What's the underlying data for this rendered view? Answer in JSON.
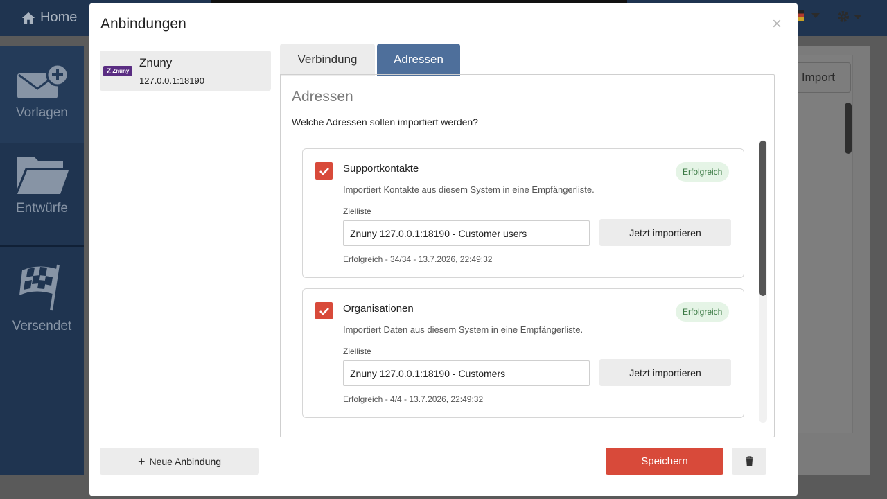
{
  "app": {
    "home_label": "Home",
    "sidebar": [
      {
        "label": "Vorlagen",
        "icon": "mail-plus-icon"
      },
      {
        "label": "Entwürfe",
        "icon": "folder-icon"
      },
      {
        "label": "Versendet",
        "icon": "checkered-flag-icon"
      }
    ],
    "import_label": "Import"
  },
  "modal": {
    "title": "Anbindungen",
    "close_symbol": "×",
    "connections": [
      {
        "name": "Znuny",
        "host": "127.0.0.1:18190",
        "logo_text": "Znuny"
      }
    ],
    "tabs": [
      {
        "label": "Verbindung",
        "active": false
      },
      {
        "label": "Adressen",
        "active": true
      }
    ],
    "panel": {
      "heading": "Adressen",
      "question": "Welche Adressen sollen importiert werden?",
      "cards": [
        {
          "title": "Supportkontakte",
          "checked": true,
          "badge": "Erfolgreich",
          "description": "Importiert Kontakte aus diesem System in eine Empfängerliste.",
          "target_label": "Zielliste",
          "target_value": "Znuny 127.0.0.1:18190 - Customer users",
          "button_label": "Jetzt importieren",
          "status": "Erfolgreich - 34/34 - 13.7.2026, 22:49:32"
        },
        {
          "title": "Organisationen",
          "checked": true,
          "badge": "Erfolgreich",
          "description": "Importiert Daten aus diesem System in eine Empfängerliste.",
          "target_label": "Zielliste",
          "target_value": "Znuny 127.0.0.1:18190 - Customers",
          "button_label": "Jetzt importieren",
          "status": "Erfolgreich - 4/4 - 13.7.2026, 22:49:32"
        }
      ]
    },
    "footer": {
      "new_connection_label": "Neue Anbindung",
      "save_label": "Speichern"
    }
  },
  "colors": {
    "accent_red": "#d84a3a",
    "tab_active": "#4e6f9b",
    "nav_bg": "#1f3450",
    "success_badge_bg": "#e5f4e6",
    "success_badge_text": "#3b7a44"
  }
}
